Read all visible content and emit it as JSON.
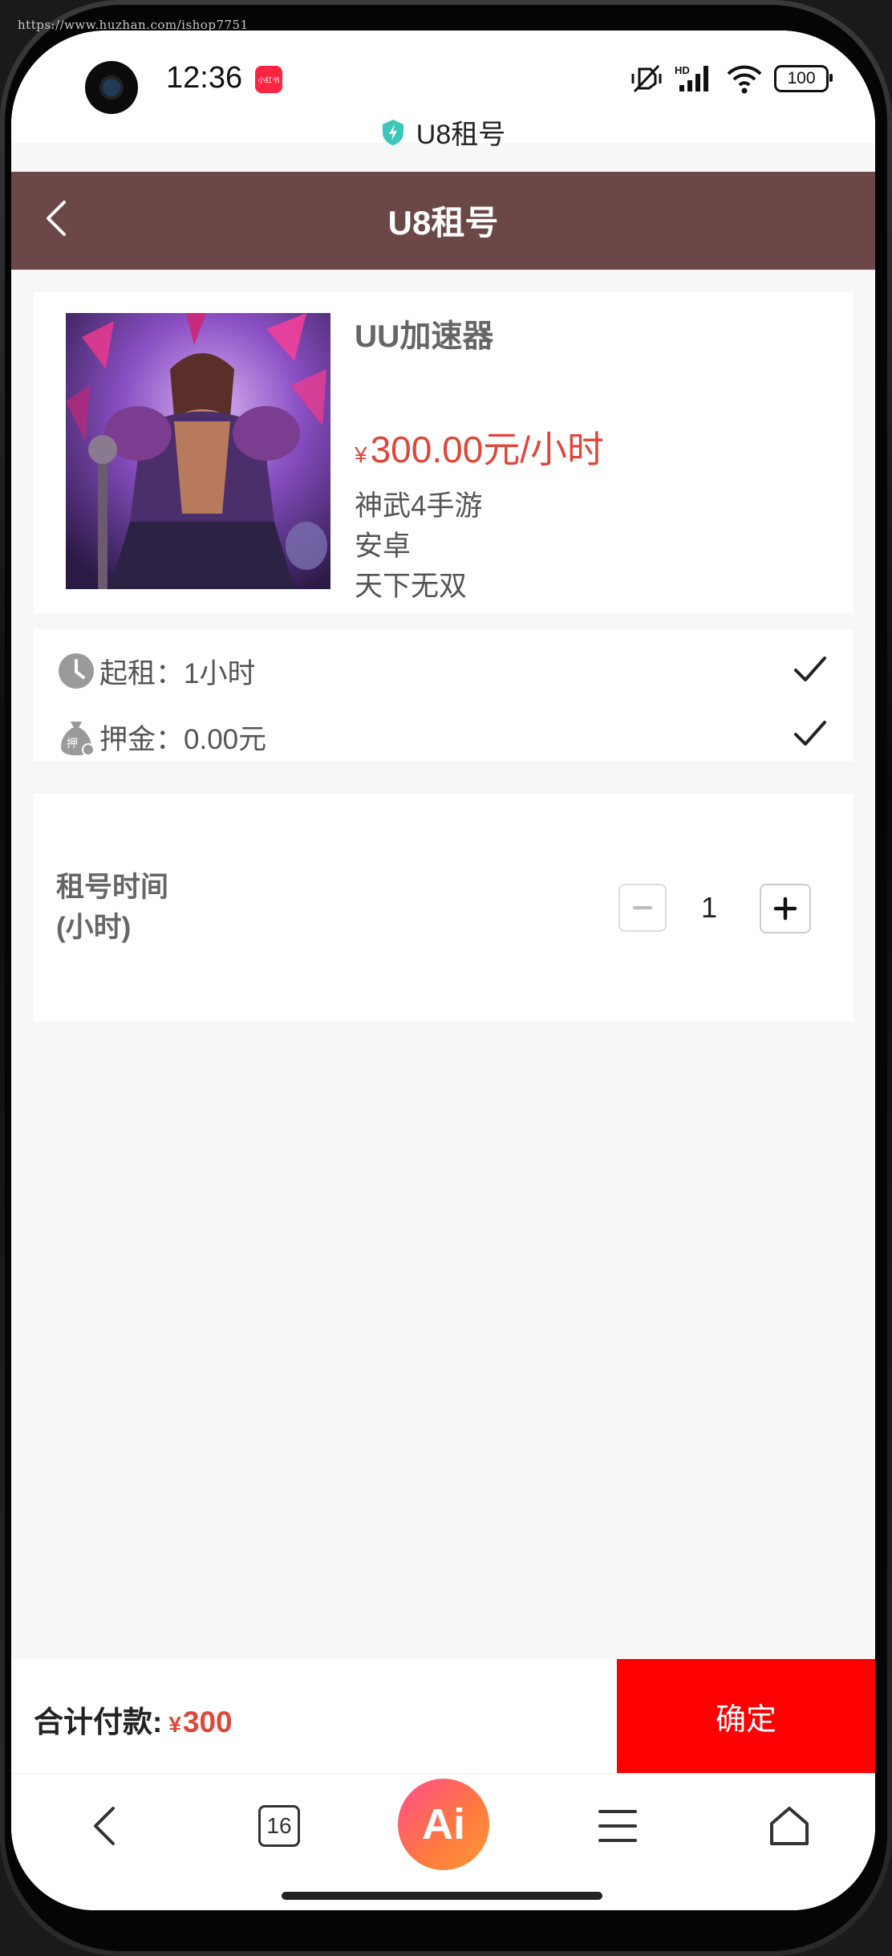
{
  "watermark": "https://www.huzhan.com/ishop7751",
  "status_bar": {
    "time": "12:36",
    "notif_app": "小红书",
    "hd_label": "HD",
    "battery": "100"
  },
  "browser": {
    "site_title": "U8租号"
  },
  "header": {
    "title": "U8租号"
  },
  "product": {
    "name": "UU加速器",
    "currency": "¥",
    "price": "300.00元/小时",
    "game": "神武4手游",
    "platform": "安卓",
    "server": "天下无双"
  },
  "rent_info": {
    "min_rent": "起租：1小时",
    "deposit": "押金：0.00元",
    "deposit_icon_text": "押"
  },
  "duration": {
    "label_line1": "租号时间",
    "label_line2": "(小时)",
    "value": "1"
  },
  "checkout": {
    "total_label": "合计付款:",
    "currency": "¥",
    "total": "300",
    "confirm_label": "确定"
  },
  "bottom_nav": {
    "tab_count": "16",
    "ai_label": "Ai"
  },
  "colors": {
    "header_bg": "#6b4747",
    "price": "#e0463a",
    "confirm_bg": "#ff0000"
  }
}
